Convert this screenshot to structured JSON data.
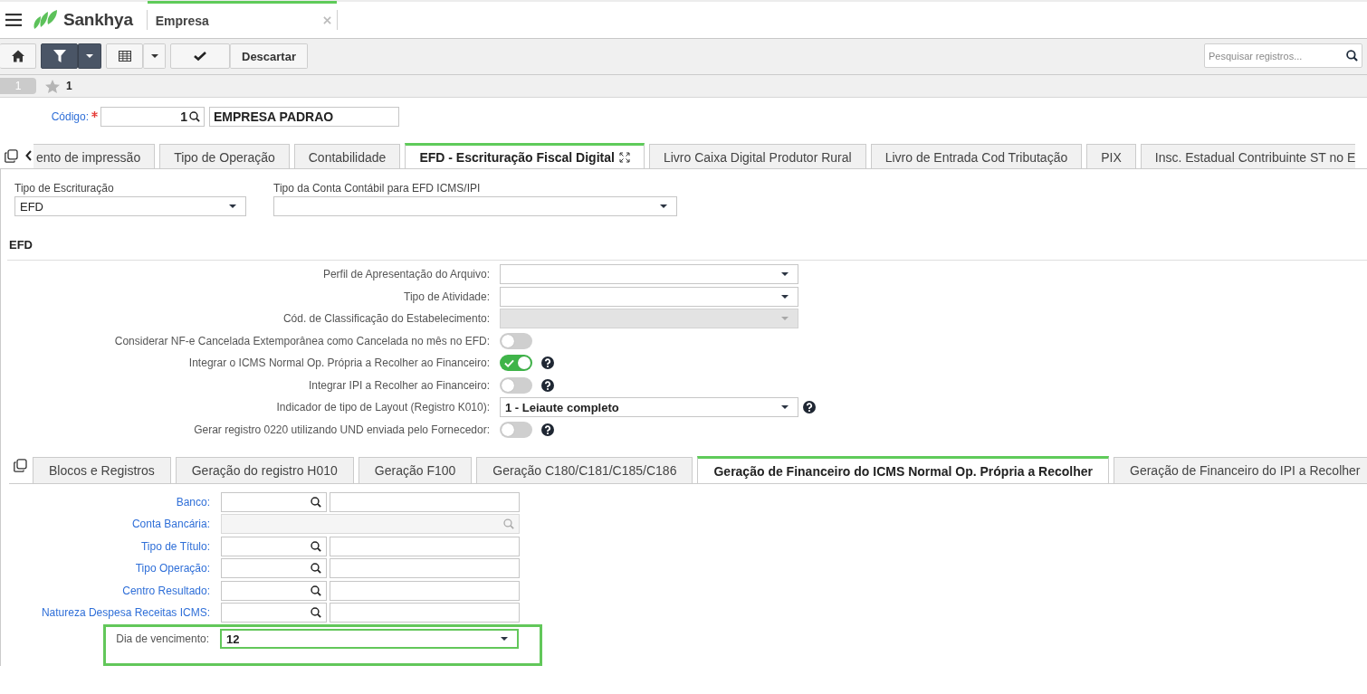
{
  "app_bar": {
    "brand": "Sankhya",
    "tabs": [
      {
        "label": "Empresa",
        "selected": true
      }
    ]
  },
  "toolbar": {
    "filter_on": true,
    "discard_label": "Descartar",
    "search": {
      "placeholder": "Pesquisar registros..."
    }
  },
  "record_bar": {
    "page": "1",
    "starred": false,
    "count": "1"
  },
  "header": {
    "code_label": "Código:",
    "required": true,
    "code_value": "1",
    "name_value": "EMPRESA PADRAO"
  },
  "main_tabs": [
    {
      "label": "ento de impressão",
      "selected": false
    },
    {
      "label": "Tipo de Operação",
      "selected": false
    },
    {
      "label": "Contabilidade",
      "selected": false
    },
    {
      "label": "EFD - Escrituração Fiscal Digital",
      "selected": true
    },
    {
      "label": "Livro Caixa Digital Produtor Rural",
      "selected": false
    },
    {
      "label": "Livro de Entrada Cod Tributação",
      "selected": false
    },
    {
      "label": "PIX",
      "selected": false
    },
    {
      "label": "Insc. Estadual Contribuinte ST no E",
      "selected": false
    }
  ],
  "efd_panel": {
    "top_fields": [
      {
        "label": "Tipo de Escrituração",
        "value": "EFD"
      },
      {
        "label": "Tipo da Conta Contábil para EFD ICMS/IPI"
      }
    ],
    "section_title": "EFD",
    "rows": [
      {
        "kind": "select",
        "label": "Perfil de Apresentação do Arquivo:",
        "disabled": false
      },
      {
        "kind": "select",
        "label": "Tipo de Atividade:",
        "disabled": false
      },
      {
        "kind": "select",
        "label": "Cód. de Classificação do Estabelecimento:",
        "disabled": true
      },
      {
        "kind": "toggle",
        "label": "Considerar NF-e Cancelada Extemporânea como Cancelada no mês no EFD:",
        "on": false
      },
      {
        "kind": "toggle",
        "label": "Integrar o ICMS Normal Op. Própria a Recolher ao Financeiro:",
        "on": true,
        "help": true
      },
      {
        "kind": "toggle",
        "label": "Integrar IPI a Recolher ao Financeiro:",
        "on": false,
        "help": true
      },
      {
        "kind": "select",
        "label": "Indicador de tipo de Layout (Registro K010):",
        "value": "1 - Leiaute completo",
        "disabled": false,
        "help": true
      },
      {
        "kind": "toggle",
        "label": "Gerar registro 0220 utilizando UND enviada pelo Fornecedor:",
        "on": false,
        "help": true
      }
    ]
  },
  "sub_tabs": [
    {
      "label": "Blocos e Registros",
      "selected": false
    },
    {
      "label": "Geração do registro H010",
      "selected": false
    },
    {
      "label": "Geração F100",
      "selected": false
    },
    {
      "label": "Geração C180/C181/C185/C186",
      "selected": false
    },
    {
      "label": "Geração de Financeiro do ICMS Normal Op. Própria a Recolher",
      "selected": true
    },
    {
      "label": "Geração de Financeiro do IPI a Recolher",
      "selected": false
    }
  ],
  "finance_fields": [
    {
      "kind": "lookup",
      "label": "Banco:",
      "disabled": false,
      "highlighted": false
    },
    {
      "kind": "lookup",
      "label": "Conta Bancária:",
      "disabled": true,
      "highlighted": false
    },
    {
      "kind": "lookup",
      "label": "Tipo de Título:",
      "disabled": false,
      "highlighted": false
    },
    {
      "kind": "lookup",
      "label": "Tipo Operação:",
      "disabled": false,
      "highlighted": false
    },
    {
      "kind": "lookup",
      "label": "Centro Resultado:",
      "disabled": false,
      "highlighted": false
    },
    {
      "kind": "lookup",
      "label": "Natureza Despesa Receitas ICMS:",
      "disabled": false,
      "highlighted": false
    },
    {
      "kind": "select",
      "label": "Dia de vencimento:",
      "value": "12",
      "highlighted": true
    }
  ]
}
